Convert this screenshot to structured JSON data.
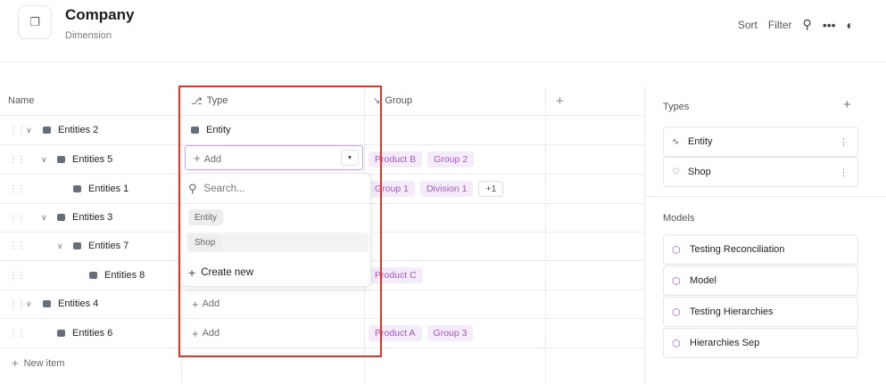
{
  "header": {
    "title": "Company",
    "subtitle": "Dimension",
    "sort_label": "Sort",
    "filter_label": "Filter"
  },
  "columns": {
    "name": "Name",
    "type": "Type",
    "group": "Group"
  },
  "rows": [
    {
      "name": "Entities 2",
      "type": "Entity",
      "groups": []
    },
    {
      "name": "Entities 5",
      "type": "",
      "groups": [
        "Product B",
        "Group 2"
      ]
    },
    {
      "name": "Entities 1",
      "type": "",
      "groups": [
        "Group 1",
        "Division 1"
      ],
      "more": "+1"
    },
    {
      "name": "Entities 3",
      "type": "",
      "groups": []
    },
    {
      "name": "Entities 7",
      "type": "",
      "groups": []
    },
    {
      "name": "Entities 8",
      "type": "",
      "groups": [
        "Product C"
      ]
    },
    {
      "name": "Entities 4",
      "type": "",
      "groups": []
    },
    {
      "name": "Entities 6",
      "type": "",
      "groups": [
        "Product A",
        "Group 3"
      ]
    }
  ],
  "add_label": "Add",
  "new_item_label": "New item",
  "dropdown": {
    "search_placeholder": "Search...",
    "options": [
      "Entity",
      "Shop"
    ],
    "create_label": "Create new"
  },
  "panel": {
    "types_title": "Types",
    "types": [
      "Entity",
      "Shop"
    ],
    "models_title": "Models",
    "models": [
      "Testing Reconciliation",
      "Model",
      "Testing Hierarchies",
      "Hierarchies Sep"
    ]
  },
  "colors": {
    "accent_purple": "#a358c6",
    "tag_bg": "#f4ecf9",
    "highlight_red": "#e2342a"
  }
}
